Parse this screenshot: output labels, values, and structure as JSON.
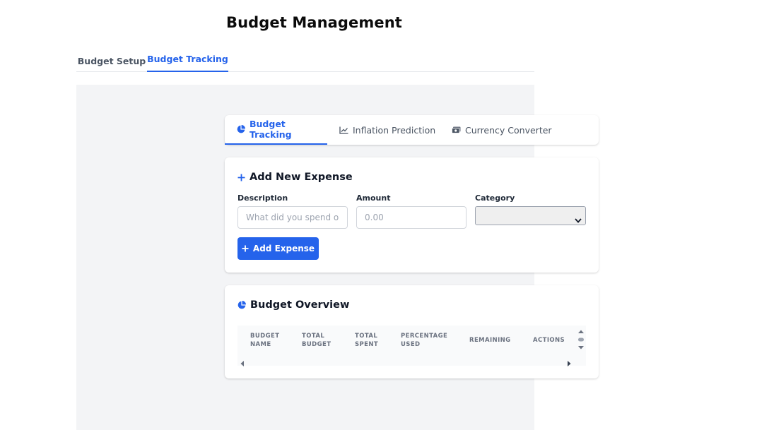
{
  "page": {
    "title": "Budget Management"
  },
  "top_tabs": [
    {
      "label": "Budget Setup",
      "active": false
    },
    {
      "label": "Budget Tracking",
      "active": true
    }
  ],
  "sub_tabs": [
    {
      "label": "Budget Tracking",
      "icon": "pie-chart-icon",
      "active": true
    },
    {
      "label": "Inflation Prediction",
      "icon": "line-chart-icon",
      "active": false
    },
    {
      "label": "Currency Converter",
      "icon": "money-bill-icon",
      "active": false
    }
  ],
  "expense_form": {
    "title": "Add New Expense",
    "description_label": "Description",
    "description_placeholder": "What did you spend on?",
    "amount_label": "Amount",
    "amount_placeholder": "0.00",
    "category_label": "Category",
    "category_value": "",
    "submit_label": "Add Expense"
  },
  "overview": {
    "title": "Budget Overview",
    "columns": [
      "Budget Name",
      "Total Budget",
      "Total Spent",
      "Percentage Used",
      "Remaining",
      "Actions"
    ],
    "rows": []
  },
  "colors": {
    "accent": "#2563eb",
    "panel_bg": "#f3f4f6"
  }
}
